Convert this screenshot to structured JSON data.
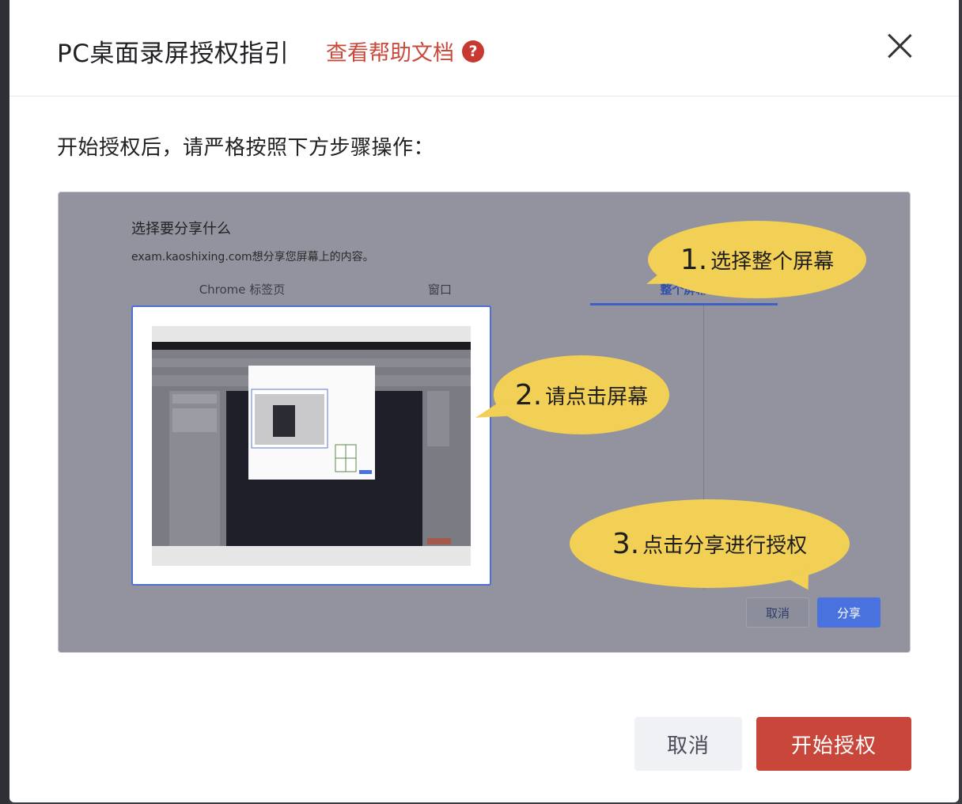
{
  "dialog": {
    "title": "PC桌面录屏授权指引",
    "help_link": "查看帮助文档",
    "help_icon": "?",
    "instruction": "开始授权后，请严格按照下方步骤操作："
  },
  "guide": {
    "share_title": "选择要分享什么",
    "share_subtitle": "exam.kaoshixing.com想分享您屏幕上的内容。",
    "tabs": [
      {
        "label": "Chrome 标签页"
      },
      {
        "label": "窗口"
      },
      {
        "label": "整个屏幕",
        "active": true
      }
    ],
    "steps": [
      {
        "num": "1.",
        "text": "选择整个屏幕"
      },
      {
        "num": "2.",
        "text": "请点击屏幕"
      },
      {
        "num": "3.",
        "text": "点击分享进行授权"
      }
    ],
    "cancel_label": "取消",
    "share_label": "分享"
  },
  "footer": {
    "cancel_label": "取消",
    "start_label": "开始授权"
  },
  "colors": {
    "accent": "#c8463a",
    "link": "#c84a3c",
    "bubble": "#f2cf55",
    "share_button": "#4a72de"
  },
  "icons": {
    "help": "question-circle-icon",
    "close": "close-icon"
  }
}
